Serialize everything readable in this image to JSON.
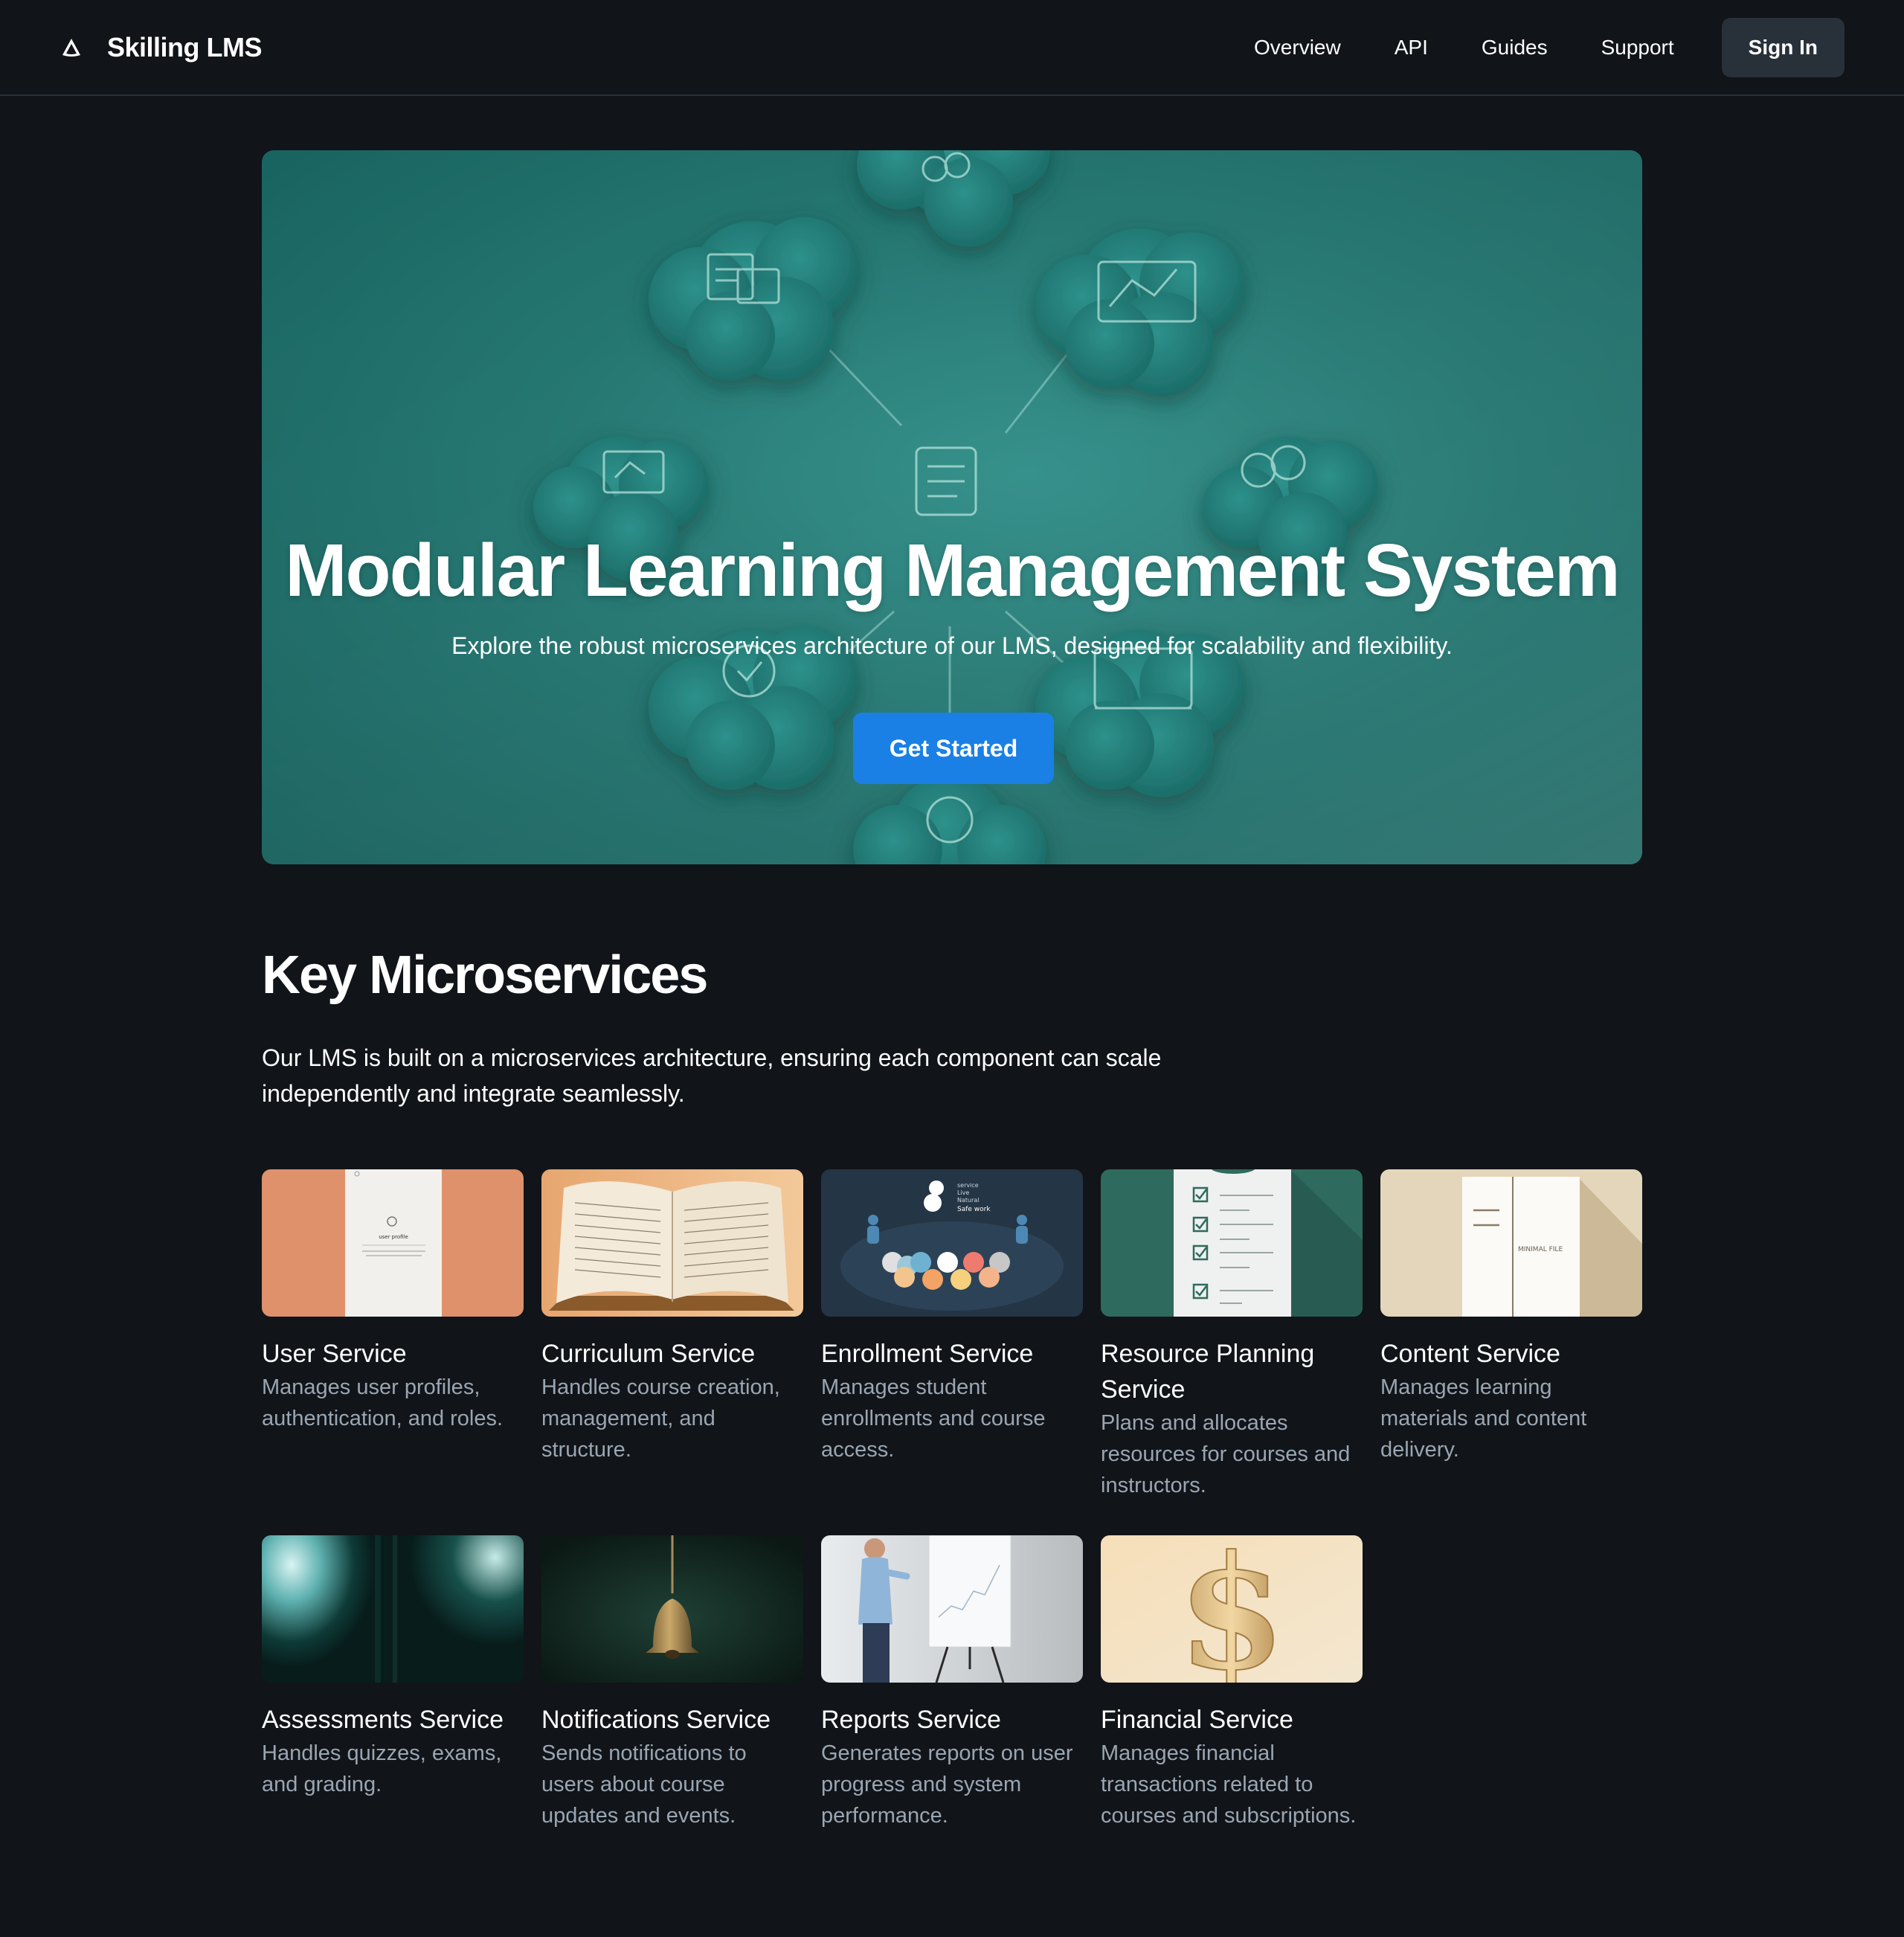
{
  "header": {
    "brand": "Skilling LMS",
    "nav": [
      "Overview",
      "API",
      "Guides",
      "Support"
    ],
    "signin_label": "Sign In"
  },
  "hero": {
    "title": "Modular Learning Management System",
    "subtitle": "Explore the robust microservices architecture of our LMS, designed for scalability and flexibility.",
    "cta_label": "Get Started"
  },
  "section": {
    "title": "Key Microservices",
    "description": "Our LMS is built on a microservices architecture, ensuring each component can scale independently and integrate seamlessly."
  },
  "services": [
    {
      "title": "User Service",
      "description": "Manages user profiles, authentication, and roles.",
      "image": "user-profile-document"
    },
    {
      "title": "Curriculum Service",
      "description": "Handles course creation, management, and structure.",
      "image": "open-book"
    },
    {
      "title": "Enrollment Service",
      "description": "Manages student enrollments and course access.",
      "image": "enrollment-illustration"
    },
    {
      "title": "Resource Planning Service",
      "description": "Plans and allocates resources for courses and instructors.",
      "image": "checklist"
    },
    {
      "title": "Content Service",
      "description": "Manages learning materials and content delivery.",
      "image": "minimal-file"
    },
    {
      "title": "Assessments Service",
      "description": "Handles quizzes, exams, and grading.",
      "image": "light-doorway"
    },
    {
      "title": "Notifications Service",
      "description": "Sends notifications to users about course updates and events.",
      "image": "bell"
    },
    {
      "title": "Reports Service",
      "description": "Generates reports on user progress and system performance.",
      "image": "presenter-whiteboard"
    },
    {
      "title": "Financial Service",
      "description": "Manages financial transactions related to courses and subscriptions.",
      "image": "dollar-sign"
    }
  ],
  "thumb_text": {
    "user_profile": "user profile",
    "minimal_file": "MINIMAL FILE",
    "enroll_lines": [
      "service",
      "Live",
      "Natural",
      "Safe work"
    ]
  },
  "colors": {
    "background": "#111418",
    "border": "#283039",
    "accent": "#1a80e5",
    "muted_text": "#9aa6b3",
    "hero_teal": "#21746f"
  }
}
